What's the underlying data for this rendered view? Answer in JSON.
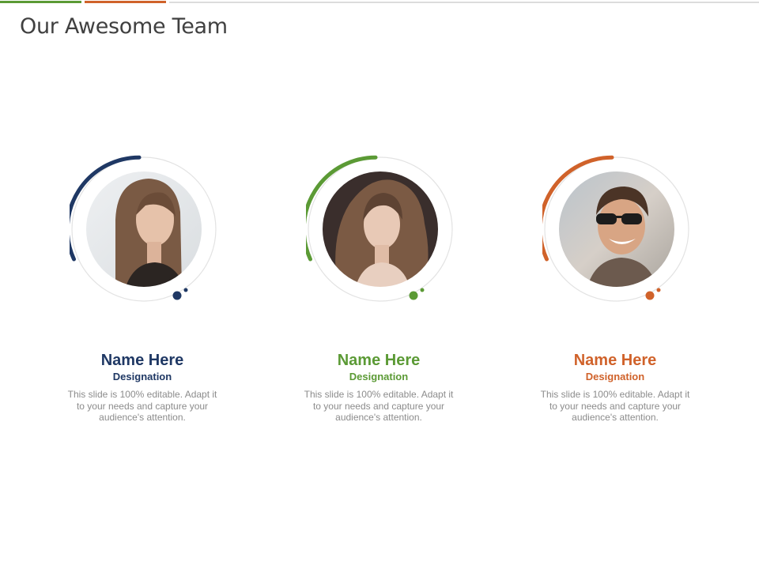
{
  "slide": {
    "title": "Our Awesome Team"
  },
  "colors": {
    "navy": "#1f3864",
    "green": "#5b9a35",
    "orange": "#d0622a",
    "gray_line": "#dcdcdc",
    "text_gray": "#8c8c8c",
    "title_gray": "#404040"
  },
  "team": [
    {
      "name": "Name Here",
      "designation": "Designation",
      "description": "This slide is 100% editable. Adapt it to your needs and capture your audience's attention.",
      "accent": "#1f3864",
      "photo": "woman-portrait-straight-hair"
    },
    {
      "name": "Name Here",
      "designation": "Designation",
      "description": "This slide is 100% editable. Adapt it to your needs and capture your audience's attention.",
      "accent": "#5b9a35",
      "photo": "woman-portrait-curly-hair"
    },
    {
      "name": "Name Here",
      "designation": "Designation",
      "description": "This slide is 100% editable. Adapt it to your needs and capture your audience's attention.",
      "accent": "#d0622a",
      "photo": "man-portrait-sunglasses"
    }
  ]
}
